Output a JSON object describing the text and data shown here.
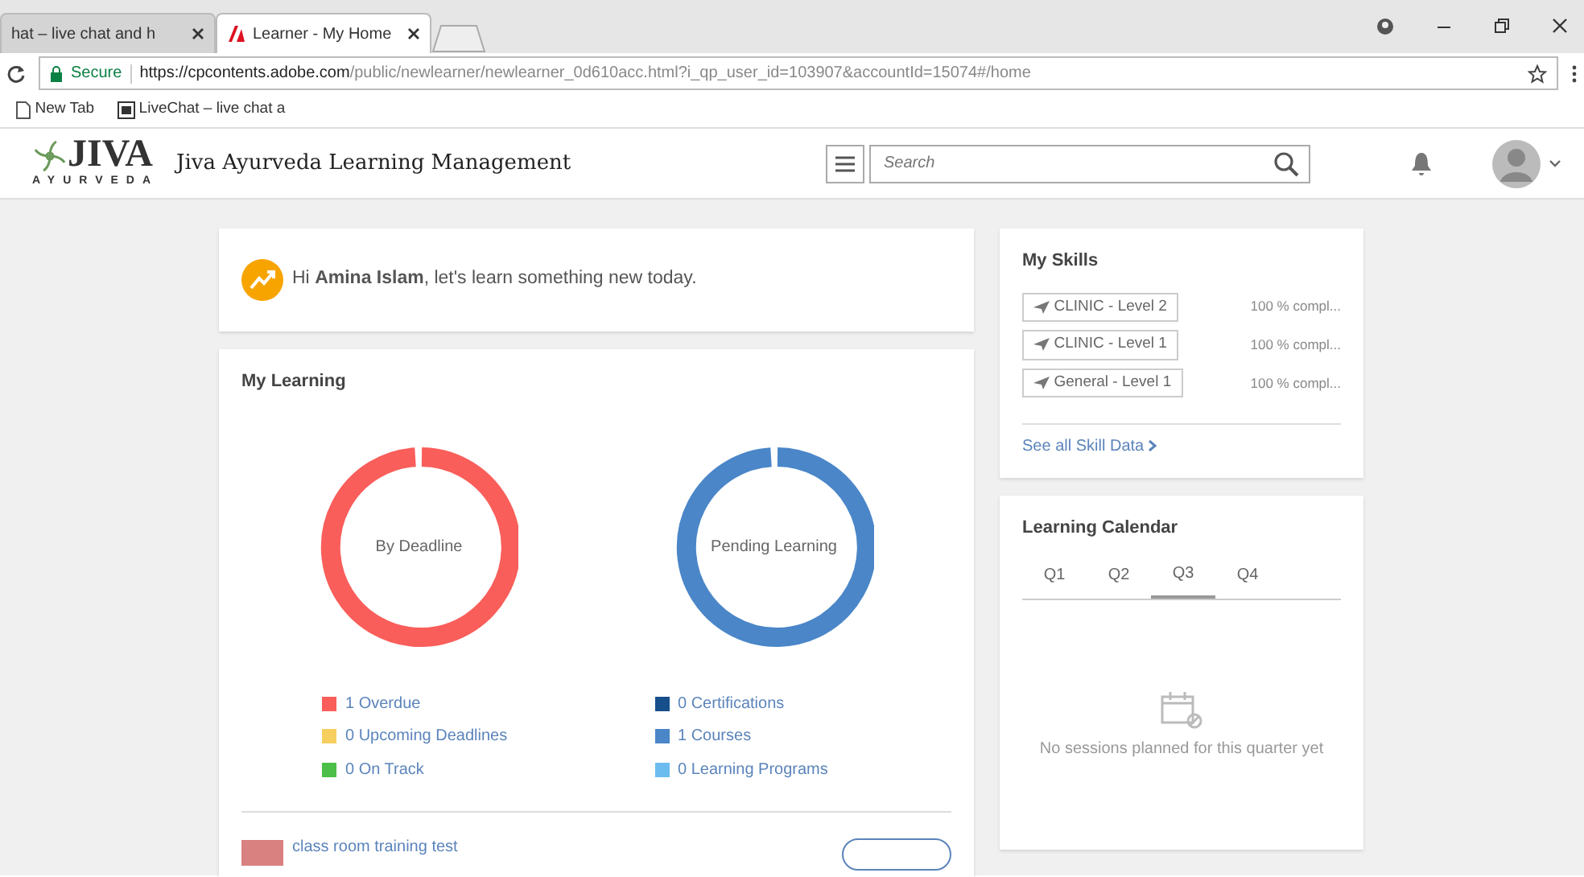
{
  "browser": {
    "tabs": [
      {
        "title": "hat – live chat and h",
        "selected": false
      },
      {
        "title": "Learner - My Home",
        "selected": true
      }
    ],
    "address": {
      "secure": "Secure",
      "host": "https://cpcontents.adobe.com",
      "path": "/public/newlearner/newlearner_0d610acc.html?i_qp_user_id=103907&accountId=15074#/home"
    },
    "bookmarks": [
      {
        "label": "New Tab",
        "kind": "page"
      },
      {
        "label": "LiveChat – live chat a",
        "kind": "site"
      }
    ]
  },
  "app": {
    "logo": "JIVA",
    "logo_sub": "AYURVEDA",
    "title": "Jiva Ayurveda Learning Management",
    "search": {
      "placeholder": "Search"
    }
  },
  "greeting": "Hi **Amina Islam**, let's learn something new today.",
  "my_learning": {
    "title": "My Learning",
    "donuts": [
      {
        "label": "By Deadline",
        "color": "#f95e5a"
      },
      {
        "label": "Pending Learning",
        "color": "#4a86c8"
      }
    ],
    "legends": [
      [
        {
          "label": "1 Overdue",
          "color": "#f95e5a"
        },
        {
          "label": "0 Upcoming Deadlines",
          "color": "#f6cf5f"
        },
        {
          "label": "0 On Track",
          "color": "#4bbf48"
        }
      ],
      [
        {
          "label": "0 Certifications",
          "color": "#164f8c"
        },
        {
          "label": "1 Courses",
          "color": "#4a86c8"
        },
        {
          "label": "0 Learning Programs",
          "color": "#6cbcf0"
        }
      ]
    ],
    "course": {
      "title": "class room training test"
    }
  },
  "my_skills": {
    "title": "My Skills",
    "items": [
      {
        "name": "CLINIC - Level 2",
        "status": "100 % compl..."
      },
      {
        "name": "CLINIC - Level 1",
        "status": "100 % compl..."
      },
      {
        "name": "General - Level 1",
        "status": "100 % compl..."
      }
    ],
    "link": "See all Skill Data"
  },
  "calendar": {
    "title": "Learning Calendar",
    "quarters": [
      {
        "label": "Q1",
        "selected": false
      },
      {
        "label": "Q2",
        "selected": false
      },
      {
        "label": "Q3",
        "selected": true
      },
      {
        "label": "Q4",
        "selected": false
      }
    ],
    "empty": "No sessions planned for this quarter yet"
  }
}
